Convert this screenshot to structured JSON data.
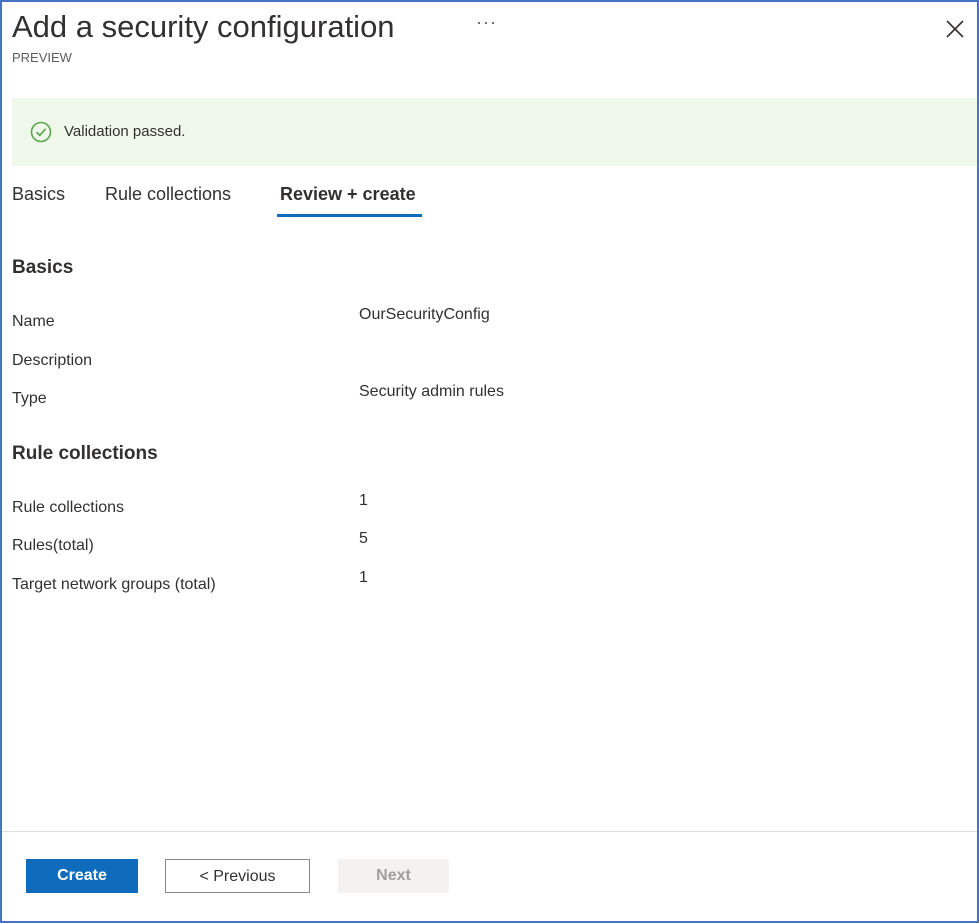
{
  "header": {
    "title": "Add a security configuration",
    "more_icon": "···",
    "subtitle": "PREVIEW",
    "close_icon": "close-icon"
  },
  "banner": {
    "icon": "check-circle-icon",
    "text": "Validation passed.",
    "accent_color": "#57a64a"
  },
  "tabs": [
    {
      "label": "Basics",
      "active": false
    },
    {
      "label": "Rule collections",
      "active": false
    },
    {
      "label": "Review + create",
      "active": true
    }
  ],
  "basics": {
    "heading": "Basics",
    "rows": [
      {
        "label": "Name",
        "value": "OurSecurityConfig"
      },
      {
        "label": "Description",
        "value": ""
      },
      {
        "label": "Type",
        "value": "Security admin rules"
      }
    ]
  },
  "rule_collections": {
    "heading": "Rule collections",
    "rows": [
      {
        "label": "Rule collections",
        "value": "1"
      },
      {
        "label": "Rules(total)",
        "value": "5"
      },
      {
        "label": "Target network groups (total)",
        "value": "1"
      }
    ]
  },
  "footer": {
    "create_label": "Create",
    "previous_label": "< Previous",
    "next_label": "Next"
  },
  "colors": {
    "primary": "#0f6cbd",
    "frame_border": "#4a72c4",
    "banner_background": "#f0f8ec"
  }
}
